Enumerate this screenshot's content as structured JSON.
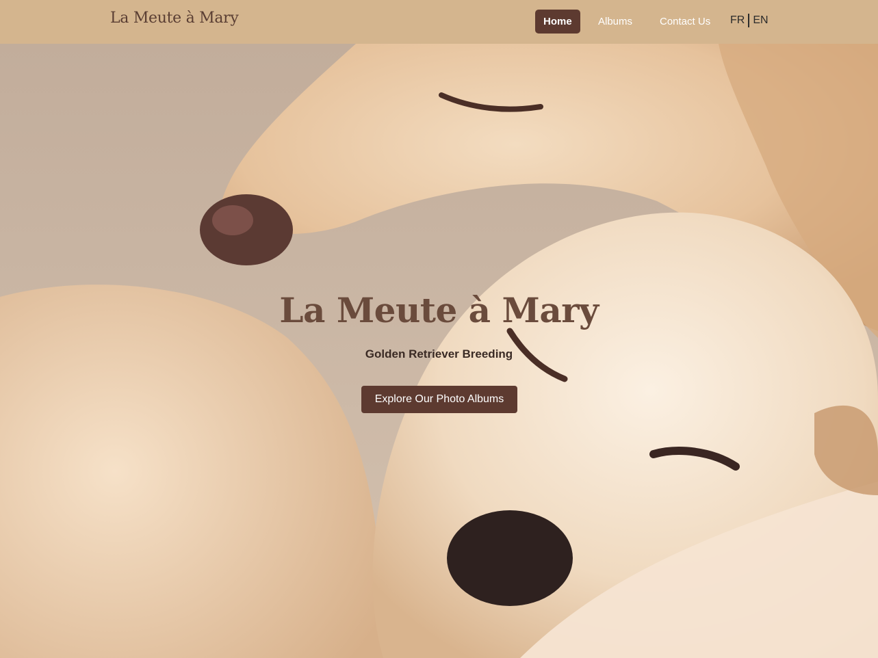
{
  "brand": {
    "name": "La Meute à Mary"
  },
  "nav": {
    "items": [
      {
        "label": "Home",
        "active": true
      },
      {
        "label": "Albums",
        "active": false
      },
      {
        "label": "Contact Us",
        "active": false
      }
    ],
    "languages": [
      "FR",
      "EN"
    ]
  },
  "hero": {
    "title": "La Meute à Mary",
    "subtitle": "Golden Retriever Breeding",
    "cta_label": "Explore Our Photo Albums",
    "image": "two-sleeping-golden-retrievers"
  },
  "colors": {
    "navbar_bg": "#d4b58e",
    "accent": "#5d3a30",
    "brand_text": "#5a3e33"
  }
}
